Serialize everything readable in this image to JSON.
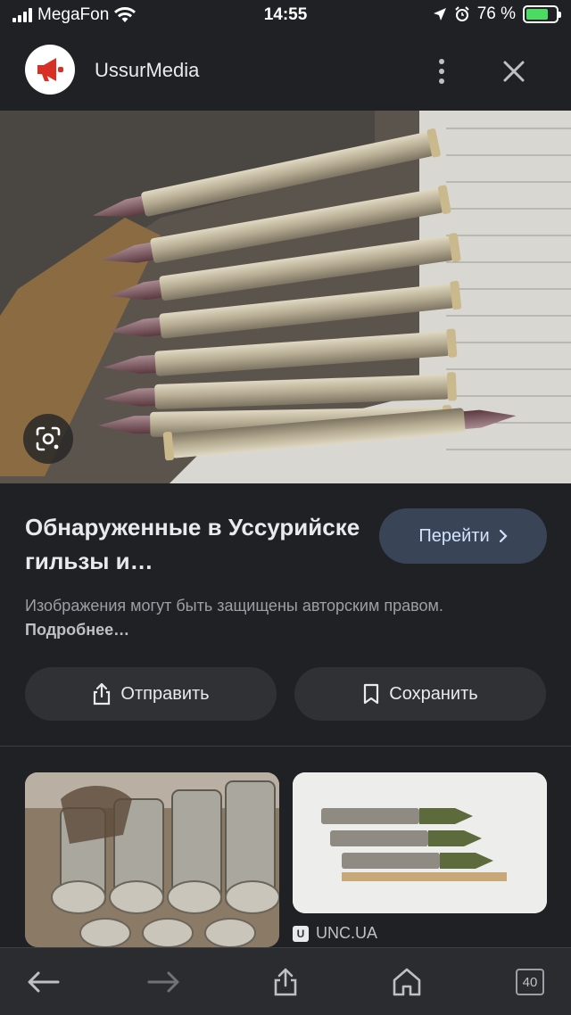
{
  "status_bar": {
    "carrier": "MegaFon",
    "time": "14:55",
    "battery": "76 %",
    "battery_level": 0.76
  },
  "header": {
    "site_name": "UssurMedia",
    "logo_icon": "megaphone-icon",
    "more_icon": "more-vert-icon",
    "close_icon": "close-icon"
  },
  "hero": {
    "lens_icon": "google-lens-icon"
  },
  "result": {
    "title": "Обнаруженные в Уссурийске гильзы и…",
    "visit_label": "Перейти",
    "copyright_text": "Изображения могут быть защищены авторским правом.",
    "more_link": "Подробнее…"
  },
  "actions": {
    "share_label": "Отправить",
    "save_label": "Сохранить"
  },
  "related": {
    "second_source": "UNC.UA",
    "second_favicon": "U"
  },
  "toolbar": {
    "tabs_count": "40"
  },
  "colors": {
    "background": "#202124",
    "accent_button": "#394457",
    "logo_red": "#d93025"
  }
}
